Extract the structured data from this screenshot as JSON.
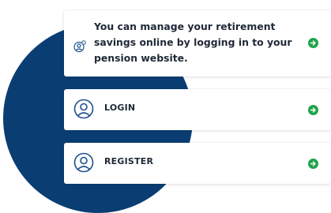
{
  "info_card": {
    "text": "You can manage your retirement savings online by logging in to your pension website.",
    "icon": "user-settings-icon",
    "arrow_icon": "arrow-right-circle-icon"
  },
  "actions": [
    {
      "label": "LOGIN",
      "icon": "user-circle-icon",
      "arrow_icon": "arrow-right-circle-icon"
    },
    {
      "label": "REGISTER",
      "icon": "user-circle-icon",
      "arrow_icon": "arrow-right-circle-icon"
    }
  ],
  "colors": {
    "blob": "#0a3e73",
    "accent_green": "#1fa34a",
    "icon_blue": "#1c4f8c",
    "text": "#1f2937"
  }
}
